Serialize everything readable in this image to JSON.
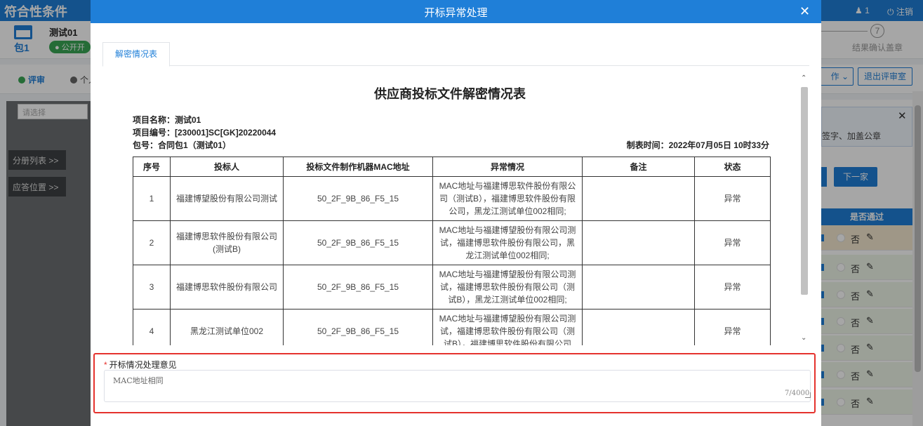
{
  "topbar": {
    "title": "符合性条件",
    "user_count": "1",
    "logout": "注销"
  },
  "package": {
    "label": "包1",
    "project": "测试01",
    "badge": "公开开"
  },
  "steps": {
    "number": "7",
    "label": "结果确认盖章"
  },
  "nav": {
    "eval": "评审",
    "personal": "个人",
    "ops": "作",
    "exit": "退出评审室"
  },
  "left": {
    "select_placeholder": "请选择",
    "list_button": "分册列表 >>",
    "answer_button": "应答位置 >>"
  },
  "right": {
    "notice": "签字、加盖公章",
    "next": "下一家",
    "col_header": "是否通过",
    "rows": [
      {
        "value": "否"
      },
      {
        "value": "否"
      },
      {
        "value": "否"
      },
      {
        "value": "否"
      },
      {
        "value": "否"
      },
      {
        "value": "否"
      },
      {
        "value": "否"
      }
    ]
  },
  "modal": {
    "title": "开标异常处理",
    "tab": "解密情况表",
    "report": {
      "title": "供应商投标文件解密情况表",
      "project_name": "项目名称：测试01",
      "project_no": "项目编号：[230001]SC[GK]20220044",
      "package": "包号：合同包1（测试01）",
      "made_time": "制表时间：2022年07月05日 10时33分",
      "headers": [
        "序号",
        "投标人",
        "投标文件制作机器MAC地址",
        "异常情况",
        "备注",
        "状态"
      ],
      "rows": [
        {
          "no": "1",
          "bidder": "福建博望股份有限公司测试",
          "mac": "50_2F_9B_86_F5_15",
          "issue": "MAC地址与福建博思软件股份有限公司（测试B），福建博思软件股份有限公司，黑龙江测试单位002相同;",
          "remark": "",
          "status": "异常"
        },
        {
          "no": "2",
          "bidder": "福建博思软件股份有限公司(测试B)",
          "mac": "50_2F_9B_86_F5_15",
          "issue": "MAC地址与福建博望股份有限公司测试，福建博思软件股份有限公司，黑龙江测试单位002相同;",
          "remark": "",
          "status": "异常"
        },
        {
          "no": "3",
          "bidder": "福建博思软件股份有限公司",
          "mac": "50_2F_9B_86_F5_15",
          "issue": "MAC地址与福建博望股份有限公司测试，福建博思软件股份有限公司（测试B），黑龙江测试单位002相同;",
          "remark": "",
          "status": "异常"
        },
        {
          "no": "4",
          "bidder": "黑龙江测试单位002",
          "mac": "50_2F_9B_86_F5_15",
          "issue": "MAC地址与福建博望股份有限公司测试，福建博思软件股份有限公司（测试B），福建博思软件股份有限公司",
          "remark": "",
          "status": "异常"
        }
      ]
    },
    "opinion": {
      "required_mark": "*",
      "label": "开标情况处理意见",
      "value": "MAC地址相同",
      "count": "7/4000"
    }
  }
}
